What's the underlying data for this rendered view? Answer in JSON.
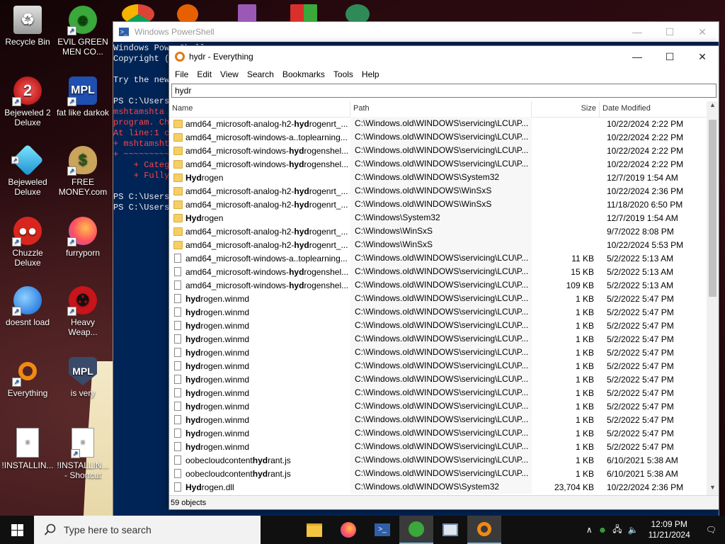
{
  "desktop": {
    "icons": [
      {
        "label": "Recycle Bin",
        "icon": "recycle-bin-icon"
      },
      {
        "label": "EVIL GREEN MEN CO...",
        "icon": "green-men-icon"
      },
      {
        "label": "Bejeweled 2 Deluxe",
        "icon": "bejeweled2-icon"
      },
      {
        "label": "fat like darkok",
        "icon": "mpl-icon"
      },
      {
        "label": "Bejeweled Deluxe",
        "icon": "bejeweled-icon"
      },
      {
        "label": "FREE MONEY.com",
        "icon": "money-bag-icon"
      },
      {
        "label": "Chuzzle Deluxe",
        "icon": "chuzzle-icon"
      },
      {
        "label": "furryporn",
        "icon": "firefox-icon"
      },
      {
        "label": "doesnt load",
        "icon": "thunderbird-icon"
      },
      {
        "label": "Heavy Weap...",
        "icon": "radiation-icon"
      },
      {
        "label": "Everything",
        "icon": "everything-icon"
      },
      {
        "label": "is very",
        "icon": "shield-icon"
      },
      {
        "label": "!INSTALLIN...",
        "icon": "text-file-icon"
      },
      {
        "label": "!INSTALLIN... - Shortcut",
        "icon": "text-file-shortcut-icon"
      }
    ]
  },
  "powershell": {
    "title": "Windows PowerShell",
    "lines": [
      {
        "text": "Windows PowerShell",
        "color": "white"
      },
      {
        "text": "Copyright (",
        "color": "white"
      },
      {
        "text": "",
        "color": "white"
      },
      {
        "text": "Try the new",
        "color": "white"
      },
      {
        "text": "",
        "color": "white"
      },
      {
        "text": "PS C:\\Users",
        "color": "white"
      },
      {
        "text": "mshtamshta",
        "color": "red"
      },
      {
        "text": "program. Ch",
        "color": "red"
      },
      {
        "text": "At line:1 c",
        "color": "red"
      },
      {
        "text": "+ mshtamsht",
        "color": "red"
      },
      {
        "text": "+ ~~~~~~~~~",
        "color": "red"
      },
      {
        "text": "    + Categ",
        "color": "red"
      },
      {
        "text": "    + Fully",
        "color": "red"
      },
      {
        "text": "",
        "color": "white"
      },
      {
        "text": "PS C:\\Users",
        "color": "white"
      },
      {
        "text": "PS C:\\Users",
        "color": "white"
      }
    ]
  },
  "everything": {
    "title": "hydr - Everything",
    "menu": [
      "File",
      "Edit",
      "View",
      "Search",
      "Bookmarks",
      "Tools",
      "Help"
    ],
    "search_value": "hydr",
    "columns": {
      "name": "Name",
      "path": "Path",
      "size": "Size",
      "date": "Date Modified"
    },
    "rows": [
      {
        "type": "folder",
        "pre": "amd64_microsoft-analog-h2-",
        "hl": "hyd",
        "post": "rogenrt_...",
        "path": "C:\\Windows.old\\WINDOWS\\servicing\\LCU\\P...",
        "size": "",
        "date": "10/22/2024 2:22 PM"
      },
      {
        "type": "folder",
        "pre": "amd64_microsoft-windows-a..toplearning...",
        "hl": "",
        "post": "",
        "path": "C:\\Windows.old\\WINDOWS\\servicing\\LCU\\P...",
        "size": "",
        "date": "10/22/2024 2:22 PM"
      },
      {
        "type": "folder",
        "pre": "amd64_microsoft-windows-",
        "hl": "hyd",
        "post": "rogenshel...",
        "path": "C:\\Windows.old\\WINDOWS\\servicing\\LCU\\P...",
        "size": "",
        "date": "10/22/2024 2:22 PM"
      },
      {
        "type": "folder",
        "pre": "amd64_microsoft-windows-",
        "hl": "hyd",
        "post": "rogenshel...",
        "path": "C:\\Windows.old\\WINDOWS\\servicing\\LCU\\P...",
        "size": "",
        "date": "10/22/2024 2:22 PM"
      },
      {
        "type": "folder",
        "pre": "",
        "hl": "Hyd",
        "post": "rogen",
        "path": "C:\\Windows.old\\WINDOWS\\System32",
        "size": "",
        "date": "12/7/2019 1:54 AM"
      },
      {
        "type": "folder",
        "pre": "amd64_microsoft-analog-h2-",
        "hl": "hyd",
        "post": "rogenrt_...",
        "path": "C:\\Windows.old\\WINDOWS\\WinSxS",
        "size": "",
        "date": "10/22/2024 2:36 PM"
      },
      {
        "type": "folder",
        "pre": "amd64_microsoft-analog-h2-",
        "hl": "hyd",
        "post": "rogenrt_...",
        "path": "C:\\Windows.old\\WINDOWS\\WinSxS",
        "size": "",
        "date": "11/18/2020 6:50 PM"
      },
      {
        "type": "folder",
        "pre": "",
        "hl": "Hyd",
        "post": "rogen",
        "path": "C:\\Windows\\System32",
        "size": "",
        "date": "12/7/2019 1:54 AM"
      },
      {
        "type": "folder",
        "pre": "amd64_microsoft-analog-h2-",
        "hl": "hyd",
        "post": "rogenrt_...",
        "path": "C:\\Windows\\WinSxS",
        "size": "",
        "date": "9/7/2022 8:08 PM"
      },
      {
        "type": "folder",
        "pre": "amd64_microsoft-analog-h2-",
        "hl": "hyd",
        "post": "rogenrt_...",
        "path": "C:\\Windows\\WinSxS",
        "size": "",
        "date": "10/22/2024 5:53 PM"
      },
      {
        "type": "file",
        "pre": "amd64_microsoft-windows-a..toplearning...",
        "hl": "",
        "post": "",
        "path": "C:\\Windows.old\\WINDOWS\\servicing\\LCU\\P...",
        "size": "11 KB",
        "date": "5/2/2022 5:13 AM"
      },
      {
        "type": "file",
        "pre": "amd64_microsoft-windows-",
        "hl": "hyd",
        "post": "rogenshel...",
        "path": "C:\\Windows.old\\WINDOWS\\servicing\\LCU\\P...",
        "size": "15 KB",
        "date": "5/2/2022 5:13 AM"
      },
      {
        "type": "file",
        "pre": "amd64_microsoft-windows-",
        "hl": "hyd",
        "post": "rogenshel...",
        "path": "C:\\Windows.old\\WINDOWS\\servicing\\LCU\\P...",
        "size": "109 KB",
        "date": "5/2/2022 5:13 AM"
      },
      {
        "type": "file",
        "pre": "",
        "hl": "hyd",
        "post": "rogen.winmd",
        "path": "C:\\Windows.old\\WINDOWS\\servicing\\LCU\\P...",
        "size": "1 KB",
        "date": "5/2/2022 5:47 PM"
      },
      {
        "type": "file",
        "pre": "",
        "hl": "hyd",
        "post": "rogen.winmd",
        "path": "C:\\Windows.old\\WINDOWS\\servicing\\LCU\\P...",
        "size": "1 KB",
        "date": "5/2/2022 5:47 PM"
      },
      {
        "type": "file",
        "pre": "",
        "hl": "hyd",
        "post": "rogen.winmd",
        "path": "C:\\Windows.old\\WINDOWS\\servicing\\LCU\\P...",
        "size": "1 KB",
        "date": "5/2/2022 5:47 PM"
      },
      {
        "type": "file",
        "pre": "",
        "hl": "hyd",
        "post": "rogen.winmd",
        "path": "C:\\Windows.old\\WINDOWS\\servicing\\LCU\\P...",
        "size": "1 KB",
        "date": "5/2/2022 5:47 PM"
      },
      {
        "type": "file",
        "pre": "",
        "hl": "hyd",
        "post": "rogen.winmd",
        "path": "C:\\Windows.old\\WINDOWS\\servicing\\LCU\\P...",
        "size": "1 KB",
        "date": "5/2/2022 5:47 PM"
      },
      {
        "type": "file",
        "pre": "",
        "hl": "hyd",
        "post": "rogen.winmd",
        "path": "C:\\Windows.old\\WINDOWS\\servicing\\LCU\\P...",
        "size": "1 KB",
        "date": "5/2/2022 5:47 PM"
      },
      {
        "type": "file",
        "pre": "",
        "hl": "hyd",
        "post": "rogen.winmd",
        "path": "C:\\Windows.old\\WINDOWS\\servicing\\LCU\\P...",
        "size": "1 KB",
        "date": "5/2/2022 5:47 PM"
      },
      {
        "type": "file",
        "pre": "",
        "hl": "hyd",
        "post": "rogen.winmd",
        "path": "C:\\Windows.old\\WINDOWS\\servicing\\LCU\\P...",
        "size": "1 KB",
        "date": "5/2/2022 5:47 PM"
      },
      {
        "type": "file",
        "pre": "",
        "hl": "hyd",
        "post": "rogen.winmd",
        "path": "C:\\Windows.old\\WINDOWS\\servicing\\LCU\\P...",
        "size": "1 KB",
        "date": "5/2/2022 5:47 PM"
      },
      {
        "type": "file",
        "pre": "",
        "hl": "hyd",
        "post": "rogen.winmd",
        "path": "C:\\Windows.old\\WINDOWS\\servicing\\LCU\\P...",
        "size": "1 KB",
        "date": "5/2/2022 5:47 PM"
      },
      {
        "type": "file",
        "pre": "",
        "hl": "hyd",
        "post": "rogen.winmd",
        "path": "C:\\Windows.old\\WINDOWS\\servicing\\LCU\\P...",
        "size": "1 KB",
        "date": "5/2/2022 5:47 PM"
      },
      {
        "type": "file",
        "pre": "",
        "hl": "hyd",
        "post": "rogen.winmd",
        "path": "C:\\Windows.old\\WINDOWS\\servicing\\LCU\\P...",
        "size": "1 KB",
        "date": "5/2/2022 5:47 PM"
      },
      {
        "type": "file",
        "pre": "oobecloudcontent",
        "hl": "hyd",
        "post": "rant.js",
        "path": "C:\\Windows.old\\WINDOWS\\servicing\\LCU\\P...",
        "size": "1 KB",
        "date": "6/10/2021 5:38 AM"
      },
      {
        "type": "file",
        "pre": "oobecloudcontent",
        "hl": "hyd",
        "post": "rant.js",
        "path": "C:\\Windows.old\\WINDOWS\\servicing\\LCU\\P...",
        "size": "1 KB",
        "date": "6/10/2021 5:38 AM"
      },
      {
        "type": "file",
        "pre": "",
        "hl": "Hyd",
        "post": "rogen.dll",
        "path": "C:\\Windows.old\\WINDOWS\\System32",
        "size": "23,704 KB",
        "date": "10/22/2024 2:36 PM"
      }
    ],
    "status": "59 objects"
  },
  "taskbar": {
    "search_placeholder": "Type here to search",
    "apps": [
      "file-explorer-icon",
      "firefox-icon",
      "powershell-icon",
      "green-men-icon",
      "window-app-icon",
      "everything-icon"
    ],
    "time": "12:09 PM",
    "date": "11/21/2024"
  },
  "colors": {
    "ps_bg": "#012456",
    "accent": "#76b9ed",
    "folder": "#f5cf63",
    "error": "#ff4444"
  }
}
